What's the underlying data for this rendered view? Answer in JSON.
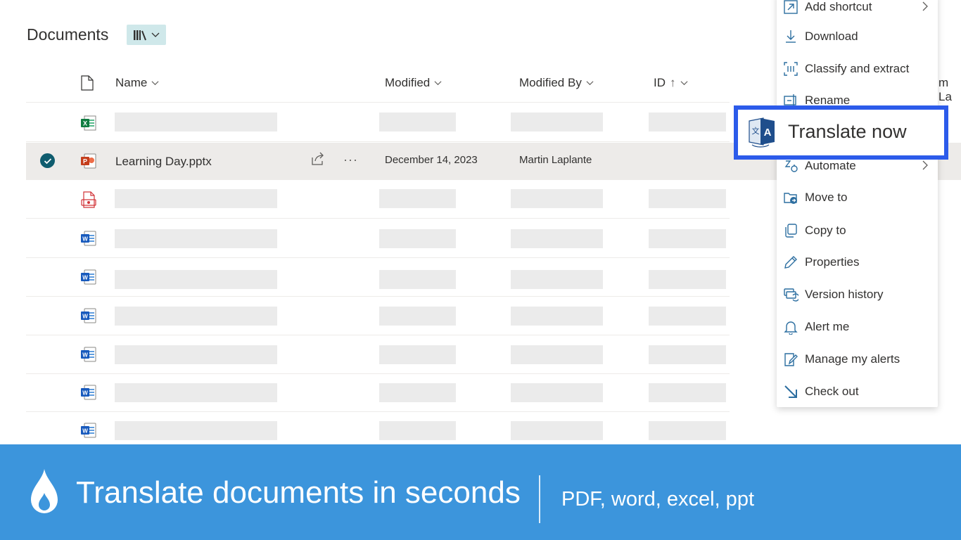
{
  "header": {
    "title": "Documents",
    "view_icon": "library-icon"
  },
  "columns": {
    "name": "Name",
    "modified": "Modified",
    "modified_by": "Modified By",
    "id": "ID",
    "id_sort": "↑",
    "cut_off": "m La"
  },
  "selected_file": {
    "name": "Learning Day.pptx",
    "modified": "December 14, 2023",
    "modified_by": "Martin Laplante",
    "more": "···"
  },
  "rows": [
    {
      "type": "excel",
      "selected": false
    },
    {
      "type": "powerpoint",
      "selected": true
    },
    {
      "type": "pdf",
      "selected": false
    },
    {
      "type": "word",
      "selected": false
    },
    {
      "type": "word",
      "selected": false
    },
    {
      "type": "word",
      "selected": false
    },
    {
      "type": "word",
      "selected": false
    },
    {
      "type": "word",
      "selected": false
    },
    {
      "type": "word",
      "selected": false
    }
  ],
  "context_menu": {
    "items": [
      {
        "label": "Add shortcut",
        "icon": "add-shortcut-icon",
        "submenu": true
      },
      {
        "label": "Download",
        "icon": "download-icon",
        "submenu": false
      },
      {
        "label": "Classify and extract",
        "icon": "classify-icon",
        "submenu": false
      },
      {
        "label": "Rename",
        "icon": "rename-icon",
        "submenu": false
      },
      {
        "label": "Automate",
        "icon": "automate-icon",
        "submenu": true
      },
      {
        "label": "Move to",
        "icon": "move-to-icon",
        "submenu": false
      },
      {
        "label": "Copy to",
        "icon": "copy-to-icon",
        "submenu": false
      },
      {
        "label": "Properties",
        "icon": "properties-icon",
        "submenu": false
      },
      {
        "label": "Version history",
        "icon": "version-history-icon",
        "submenu": false
      },
      {
        "label": "Alert me",
        "icon": "alert-bell-icon",
        "submenu": false
      },
      {
        "label": "Manage my alerts",
        "icon": "manage-alerts-icon",
        "submenu": false
      },
      {
        "label": "Check out",
        "icon": "check-out-icon",
        "submenu": false
      }
    ],
    "highlight": {
      "label": "Translate now",
      "icon": "translate-icon"
    }
  },
  "banner": {
    "title": "Translate documents in seconds",
    "subtitle": "PDF, word, excel, ppt",
    "logo": "flame-logo"
  },
  "colors": {
    "accent_highlight": "#2c5bea",
    "banner_bg": "#3c95dc",
    "selected_check": "#0f5c6e",
    "view_button_bg": "#cfe8ea"
  }
}
